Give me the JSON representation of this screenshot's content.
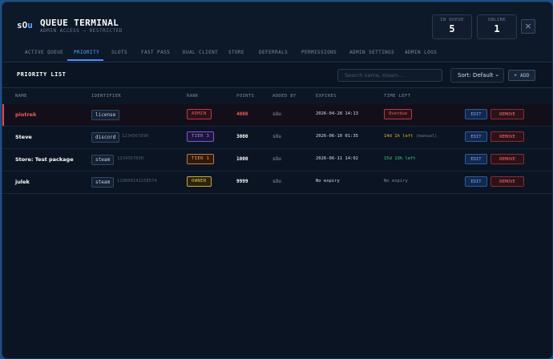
{
  "app": {
    "logo_main": "sO",
    "logo_accent": "u",
    "title": "QUEUE TERMINAL",
    "subtitle": "ADMIN ACCESS — RESTRICTED"
  },
  "stats": {
    "in_queue_label": "IN QUEUE",
    "in_queue_value": "5",
    "online_label": "ONLINE",
    "online_value": "1"
  },
  "close_icon": "×",
  "tabs": [
    {
      "label": "ACTIVE QUEUE"
    },
    {
      "label": "PRIORITY",
      "active": true
    },
    {
      "label": "SLOTS"
    },
    {
      "label": "FAST PASS"
    },
    {
      "label": "DUAL CLIENT"
    },
    {
      "label": "STORE"
    },
    {
      "label": "DEFERRALS"
    },
    {
      "label": "PERMISSIONS"
    },
    {
      "label": "ADMIN SETTINGS"
    },
    {
      "label": "ADMIN LOGS"
    }
  ],
  "section": {
    "title": "PRIORITY LIST",
    "search_placeholder": "Search name, steam...",
    "sort_label": "Sort: Default",
    "sort_icon": "chevron-down-icon",
    "add_label": "+ ADD"
  },
  "table": {
    "headers": {
      "name": "NAME",
      "identifier": "IDENTIFIER",
      "rank": "RANK",
      "points": "POINTS",
      "added_by": "ADDED BY",
      "expires": "EXPIRES",
      "time_left": "TIME LEFT"
    },
    "rows": [
      {
        "name": "piotrek",
        "id_type": "license",
        "id_value": "",
        "rank": "ADMIN",
        "points": "4000",
        "added_by": "sOu",
        "expires": "2026-04-28 14:13",
        "time_left": "Overdue",
        "edit": "EDIT",
        "remove": "REMOVE"
      },
      {
        "name": "Steve",
        "id_type": "discord",
        "id_value": "1234567890",
        "rank": "TIER 3",
        "points": "3000",
        "added_by": "sOu",
        "expires": "2026-06-10 01:35",
        "time_left": "14d 1h left",
        "time_note": "(manual)",
        "edit": "EDIT",
        "remove": "REMOVE"
      },
      {
        "name": "Store: Test package",
        "id_type": "steam",
        "id_value": "1234567890",
        "rank": "TIER 1",
        "points": "1000",
        "added_by": "sOu",
        "expires": "2026-06-11 14:02",
        "time_left": "15d 13h left",
        "edit": "EDIT",
        "remove": "REMOVE"
      },
      {
        "name": "julek",
        "id_type": "steam",
        "id_value": "110000141158574",
        "rank": "OWNER",
        "points": "9999",
        "added_by": "sOu",
        "expires": "No expiry",
        "time_left": "No expiry",
        "edit": "EDIT",
        "remove": "REMOVE"
      }
    ]
  },
  "colors": {
    "accent": "#4d90ff",
    "danger": "#ef5b5b",
    "warning": "#f0b429",
    "success": "#3fd07a",
    "rank_admin": "#e5484d",
    "rank_tier3": "#9b6bff",
    "rank_tier1": "#f08a3c",
    "rank_owner": "#e8c547"
  }
}
